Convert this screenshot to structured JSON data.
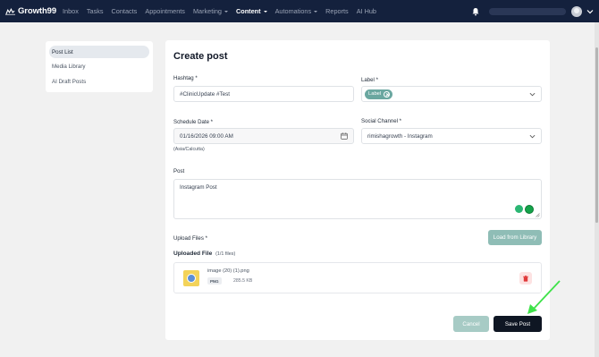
{
  "brand": {
    "name": "Growth99"
  },
  "nav": {
    "items": [
      {
        "label": "Inbox",
        "active": false,
        "dropdown": false
      },
      {
        "label": "Tasks",
        "active": false,
        "dropdown": false
      },
      {
        "label": "Contacts",
        "active": false,
        "dropdown": false
      },
      {
        "label": "Appointments",
        "active": false,
        "dropdown": false
      },
      {
        "label": "Marketing",
        "active": false,
        "dropdown": true
      },
      {
        "label": "Content",
        "active": true,
        "dropdown": true
      },
      {
        "label": "Automations",
        "active": false,
        "dropdown": true
      },
      {
        "label": "Reports",
        "active": false,
        "dropdown": false
      },
      {
        "label": "AI Hub",
        "active": false,
        "dropdown": false
      }
    ]
  },
  "sidebar": {
    "items": [
      {
        "label": "Post List",
        "active": true
      },
      {
        "label": "Media Library",
        "active": false
      },
      {
        "label": "AI Draft Posts",
        "active": false
      }
    ]
  },
  "form": {
    "title": "Create post",
    "hashtag": {
      "label": "Hashtag *",
      "value": "#ClinicUpdate #Test"
    },
    "label_field": {
      "label": "Label *",
      "chip": "Label"
    },
    "schedule": {
      "label": "Schedule Date *",
      "value": "01/16/2026 09:00 AM",
      "timezone": "(Asia/Calcutta)"
    },
    "social_channel": {
      "label": "Social Channel *",
      "value": "rimishagrowth - Instagram"
    },
    "post": {
      "label": "Post",
      "value": "Instagram Post"
    },
    "upload": {
      "label": "Upload Files *",
      "load_button": "Load from Library",
      "uploaded_title": "Uploaded File",
      "uploaded_count": "(1/1 files)",
      "file": {
        "name": "image (20) (1).png",
        "type": "PNG",
        "size": "285.5 KB"
      }
    },
    "cancel_button": "Cancel",
    "save_button": "Save Post"
  },
  "colors": {
    "nav_bg": "#14213d",
    "accent_teal": "#6aa7a0",
    "save_button": "#0f1623",
    "annotation_arrow": "#3fe24a"
  }
}
